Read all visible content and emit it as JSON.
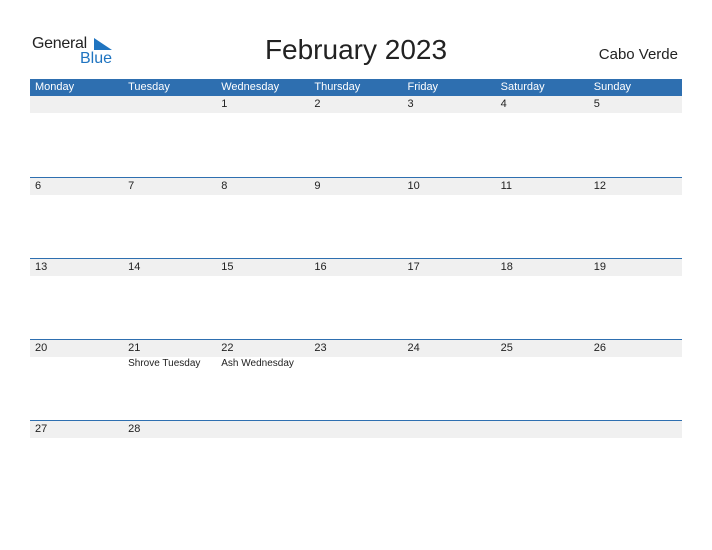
{
  "logo": {
    "general": "General",
    "blue": "Blue"
  },
  "title": "February 2023",
  "country": "Cabo Verde",
  "colors": {
    "header_bg": "#2e6fb0",
    "strip_bg": "#f0f0f0",
    "logo_blue": "#1f74c0"
  },
  "weekdays": [
    "Monday",
    "Tuesday",
    "Wednesday",
    "Thursday",
    "Friday",
    "Saturday",
    "Sunday"
  ],
  "weeks": [
    {
      "days": [
        "",
        "",
        "1",
        "2",
        "3",
        "4",
        "5"
      ],
      "events": [
        "",
        "",
        "",
        "",
        "",
        "",
        ""
      ]
    },
    {
      "days": [
        "6",
        "7",
        "8",
        "9",
        "10",
        "11",
        "12"
      ],
      "events": [
        "",
        "",
        "",
        "",
        "",
        "",
        ""
      ]
    },
    {
      "days": [
        "13",
        "14",
        "15",
        "16",
        "17",
        "18",
        "19"
      ],
      "events": [
        "",
        "",
        "",
        "",
        "",
        "",
        ""
      ]
    },
    {
      "days": [
        "20",
        "21",
        "22",
        "23",
        "24",
        "25",
        "26"
      ],
      "events": [
        "",
        "Shrove Tuesday",
        "Ash Wednesday",
        "",
        "",
        "",
        ""
      ]
    },
    {
      "days": [
        "27",
        "28",
        "",
        "",
        "",
        "",
        ""
      ],
      "events": [
        "",
        "",
        "",
        "",
        "",
        "",
        ""
      ]
    }
  ]
}
